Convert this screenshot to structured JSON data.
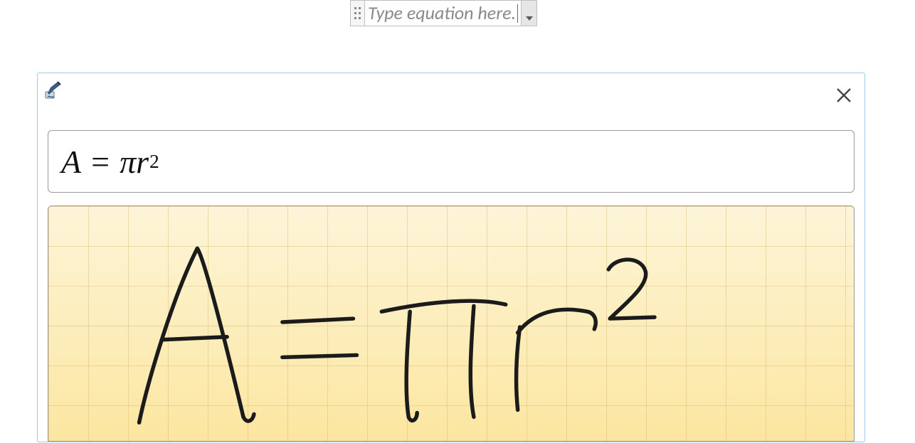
{
  "equation_box": {
    "placeholder": "Type equation here."
  },
  "ink_panel": {
    "close_label": "Close",
    "pen_icon": "ink-pen-icon",
    "preview": {
      "A": "A",
      "eq": "=",
      "pi": "π",
      "r": "r",
      "exp": "2"
    },
    "handwriting_expression": "A = π r 2"
  }
}
